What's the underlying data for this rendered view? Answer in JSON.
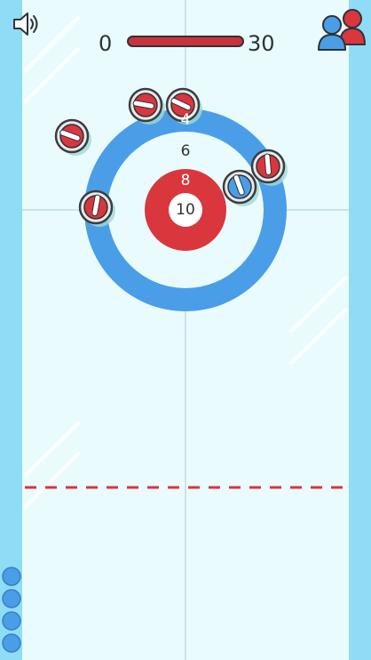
{
  "hud": {
    "score_left": "0",
    "score_right": "30",
    "sound_icon": "speaker-icon",
    "players_icon": "two-players-icon",
    "colors": {
      "red": "#d9363e",
      "blue": "#4a9ee8",
      "ice": "#e9fbfd",
      "side": "#8fdcf7"
    }
  },
  "target": {
    "ring_labels": [
      "4",
      "6",
      "8",
      "10"
    ]
  },
  "stones": [
    {
      "team": "red"
    },
    {
      "team": "red"
    },
    {
      "team": "red"
    },
    {
      "team": "red"
    },
    {
      "team": "red"
    },
    {
      "team": "blue"
    }
  ],
  "remaining_stones": {
    "team": "blue",
    "count": 4
  }
}
